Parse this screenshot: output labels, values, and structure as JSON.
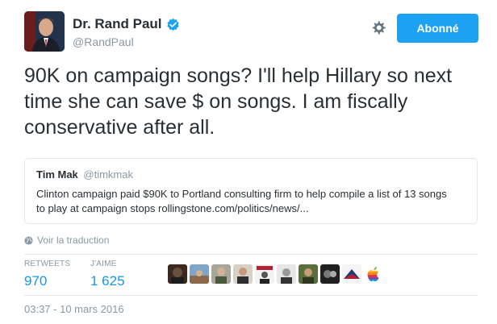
{
  "author": {
    "display_name": "Dr. Rand Paul",
    "screen_name": "@RandPaul",
    "avatar_icon": "author-avatar",
    "verified_icon": "verified-badge-icon"
  },
  "actions": {
    "settings_icon": "gear-icon",
    "follow_label": "Abonné",
    "follow_color": "#1da1f2"
  },
  "tweet": {
    "text": "90K on campaign songs? I'll help Hillary so next time she can save $ on songs. I am fiscally conservative after all."
  },
  "quoted_tweet": {
    "name": "Tim Mak",
    "handle": "@timkmak",
    "text": "Clinton campaign paid $90K to Portland consulting firm to help compile a list of 13 songs to play at campaign stops rollingstone.com/politics/news/..."
  },
  "translate": {
    "label": "Voir la traduction",
    "icon": "globe-icon"
  },
  "stats": {
    "retweets_label": "RETWEETS",
    "retweets_value": "970",
    "likes_label": "J'AIME",
    "likes_value": "1 625",
    "accent_color": "#1b95e0"
  },
  "likers": [
    {
      "icon": "liker-avatar-1"
    },
    {
      "icon": "liker-avatar-2"
    },
    {
      "icon": "liker-avatar-3"
    },
    {
      "icon": "liker-avatar-4"
    },
    {
      "icon": "liker-avatar-5"
    },
    {
      "icon": "liker-avatar-6"
    },
    {
      "icon": "liker-avatar-7"
    },
    {
      "icon": "liker-avatar-8"
    },
    {
      "icon": "liker-avatar-9"
    },
    {
      "icon": "apple-logo-icon"
    }
  ],
  "timestamp": "03:37 - 10 mars 2016"
}
